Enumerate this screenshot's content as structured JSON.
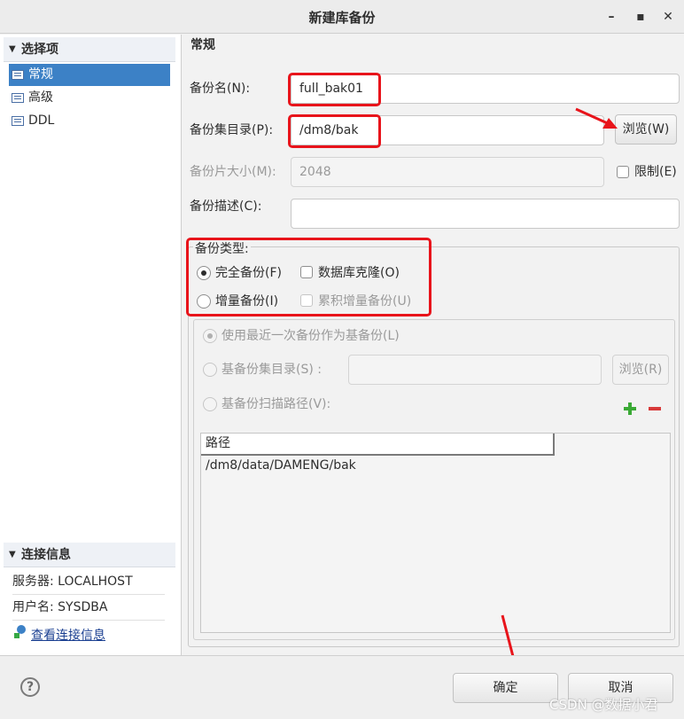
{
  "window": {
    "title": "新建库备份",
    "minimize_icon": "minimize-icon",
    "maximize_icon": "maximize-icon",
    "close_icon": "close-icon"
  },
  "sidebar": {
    "section_title": "选择项",
    "items": [
      {
        "label": "常规",
        "selected": true
      },
      {
        "label": "高级",
        "selected": false
      },
      {
        "label": "DDL",
        "selected": false
      }
    ]
  },
  "connection": {
    "section_title": "连接信息",
    "server": "服务器: LOCALHOST",
    "user": "用户名: SYSDBA",
    "view_link": "查看连接信息"
  },
  "form": {
    "section_title": "常规",
    "backup_name_label": "备份名(N):",
    "backup_name_value": "full_bak01",
    "backup_dir_label": "备份集目录(P):",
    "backup_dir_value": "/dm8/bak",
    "browse_label": "浏览(W)",
    "piece_size_label": "备份片大小(M):",
    "piece_size_value": "2048",
    "limit_label": "限制(E)",
    "desc_label": "备份描述(C):",
    "desc_value": "",
    "backup_type_label": "备份类型:",
    "full_backup_label": "完全备份(F)",
    "db_clone_label": "数据库克隆(O)",
    "incremental_label": "增量备份(I)",
    "cumulative_label": "累积增量备份(U)"
  },
  "incremental": {
    "use_latest_label": "使用最近一次备份作为基备份(L)",
    "base_dir_label": "基备份集目录(S) :",
    "base_dir_value": "",
    "browse_label": "浏览(R)",
    "scan_path_label": "基备份扫描路径(V):",
    "add_icon": "plus-icon",
    "remove_icon": "minus-icon",
    "table_header": "路径",
    "paths": [
      "/dm8/data/DAMENG/bak"
    ]
  },
  "footer": {
    "help_icon": "help-icon",
    "ok_label": "确定",
    "cancel_label": "取消",
    "watermark": "CSDN @数据小君"
  },
  "colors": {
    "selection": "#3c81c6",
    "annotation": "#e8141b"
  }
}
